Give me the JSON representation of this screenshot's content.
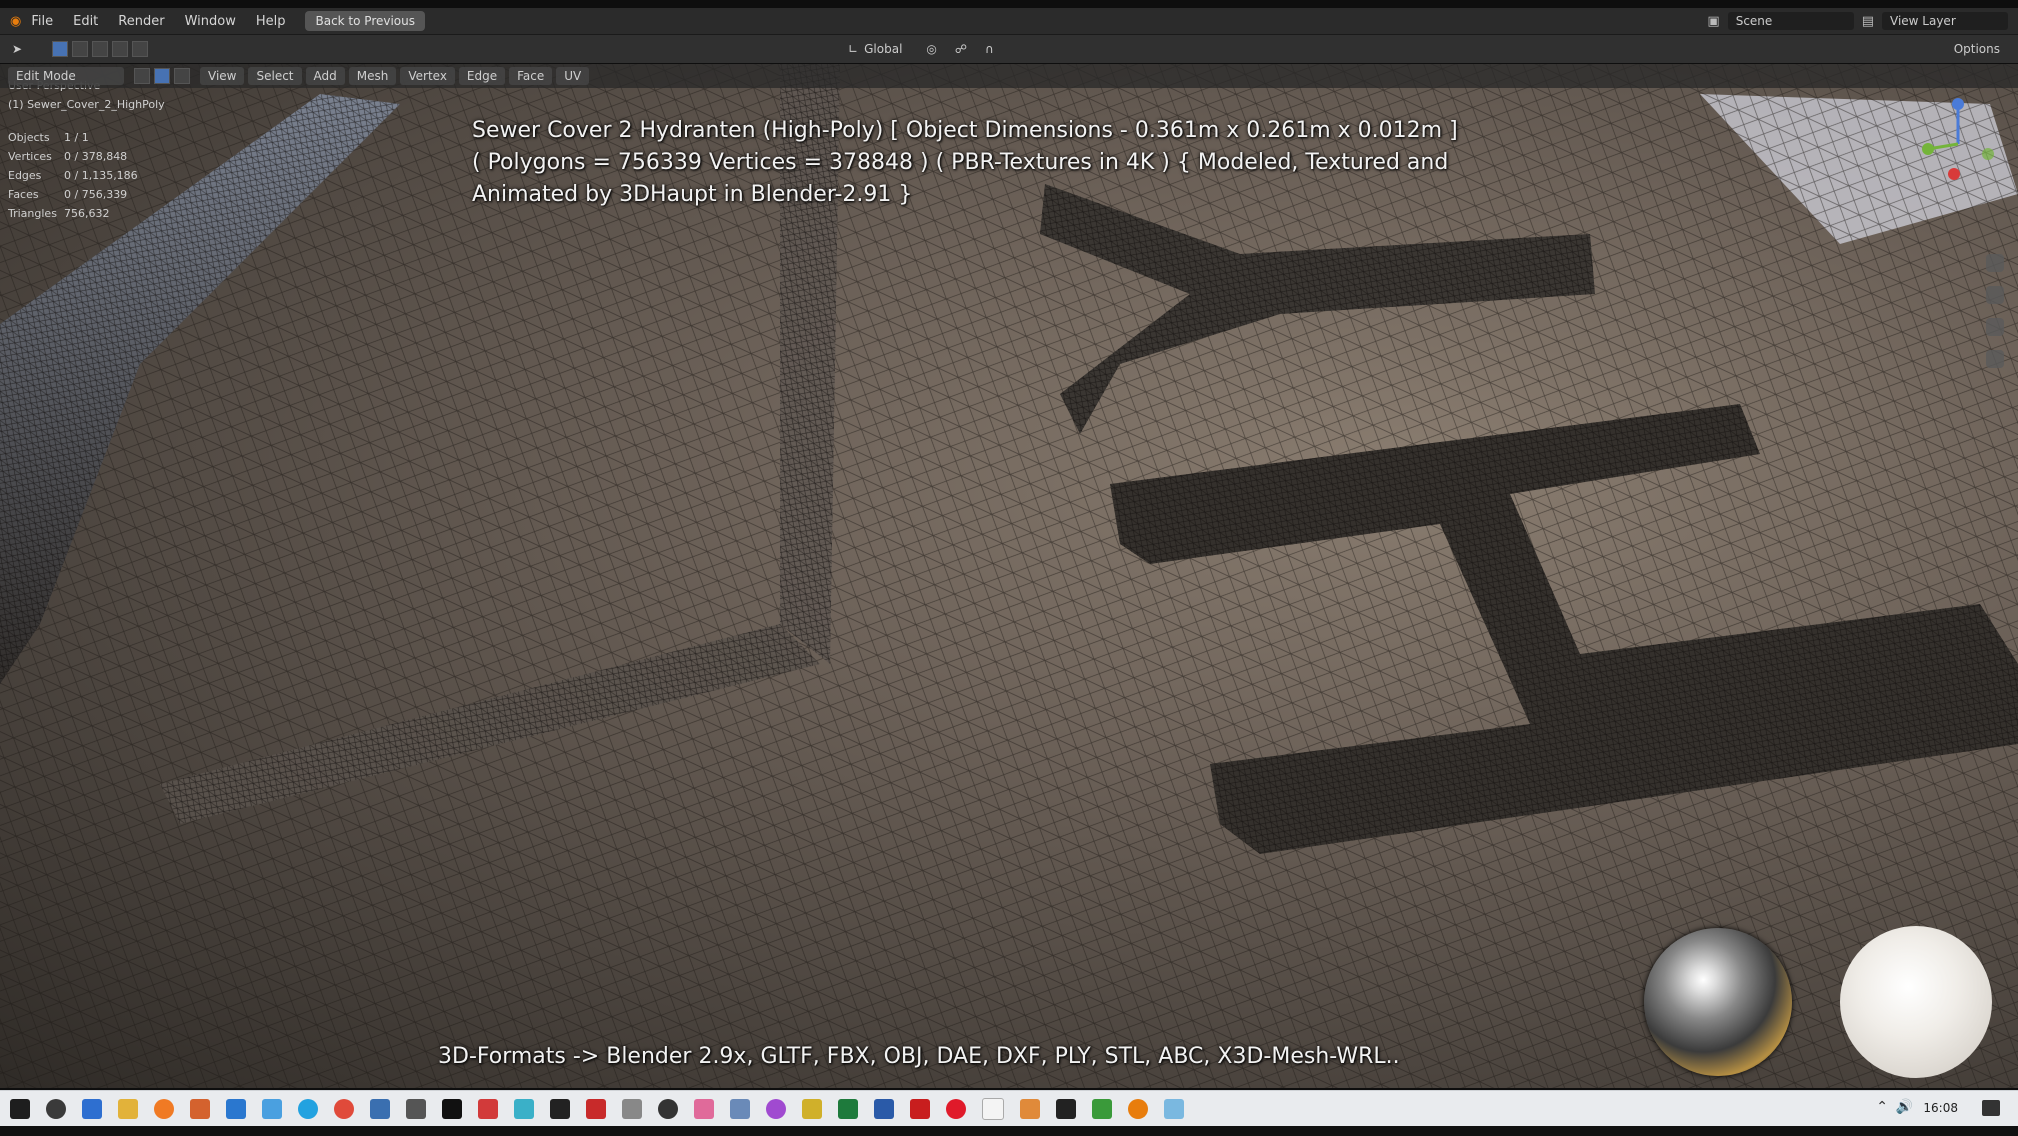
{
  "menubar": {
    "items": [
      "File",
      "Edit",
      "Render",
      "Window",
      "Help"
    ],
    "back_button": "Back to Previous",
    "scene_label": "Scene",
    "view_layer_label": "View Layer"
  },
  "toolbar": {
    "transform_orientation": "Global",
    "options_label": "Options"
  },
  "viewport_header": {
    "mode": "Edit Mode",
    "menus": [
      "View",
      "Select",
      "Add",
      "Mesh",
      "Vertex",
      "Edge",
      "Face",
      "UV"
    ]
  },
  "overlay": {
    "perspective": "User Perspective",
    "object_name": "(1) Sewer_Cover_2_HighPoly",
    "stats": [
      {
        "label": "Objects",
        "value": "1 / 1"
      },
      {
        "label": "Vertices",
        "value": "0 / 378,848"
      },
      {
        "label": "Edges",
        "value": "0 / 1,135,186"
      },
      {
        "label": "Faces",
        "value": "0 / 756,339"
      },
      {
        "label": "Triangles",
        "value": "756,632"
      }
    ]
  },
  "captions": {
    "top_line1": "Sewer Cover 2 Hydranten (High-Poly) [ Object Dimensions -  0.361m x 0.261m x 0.012m ]",
    "top_line2": "( Polygons = 756339 Vertices = 378848 ) ( PBR-Textures in 4K ) { Modeled, Textured and",
    "top_line3": "Animated by 3DHaupt in Blender-2.91 }",
    "bottom": "3D-Formats -> Blender 2.9x, GLTF, FBX, OBJ, DAE, DXF, PLY, STL, ABC, X3D-Mesh-WRL.."
  },
  "taskbar": {
    "time": "16:08",
    "icons": [
      "windows-start",
      "search",
      "file-explorer",
      "folder",
      "firefox",
      "notepad",
      "outlook",
      "skype",
      "chrome",
      "store",
      "app",
      "blender-alt",
      "paint",
      "app2",
      "app3",
      "acrobat",
      "app4",
      "app5",
      "app6",
      "app7",
      "app8",
      "app9",
      "excel",
      "word",
      "app10",
      "opera",
      "notepad2",
      "app11",
      "terminal",
      "app12",
      "blender",
      "app13"
    ]
  },
  "colors": {
    "accent": "#4772b3",
    "menubar_bg": "#2b2b2b",
    "taskbar_bg": "#e9ebee"
  }
}
